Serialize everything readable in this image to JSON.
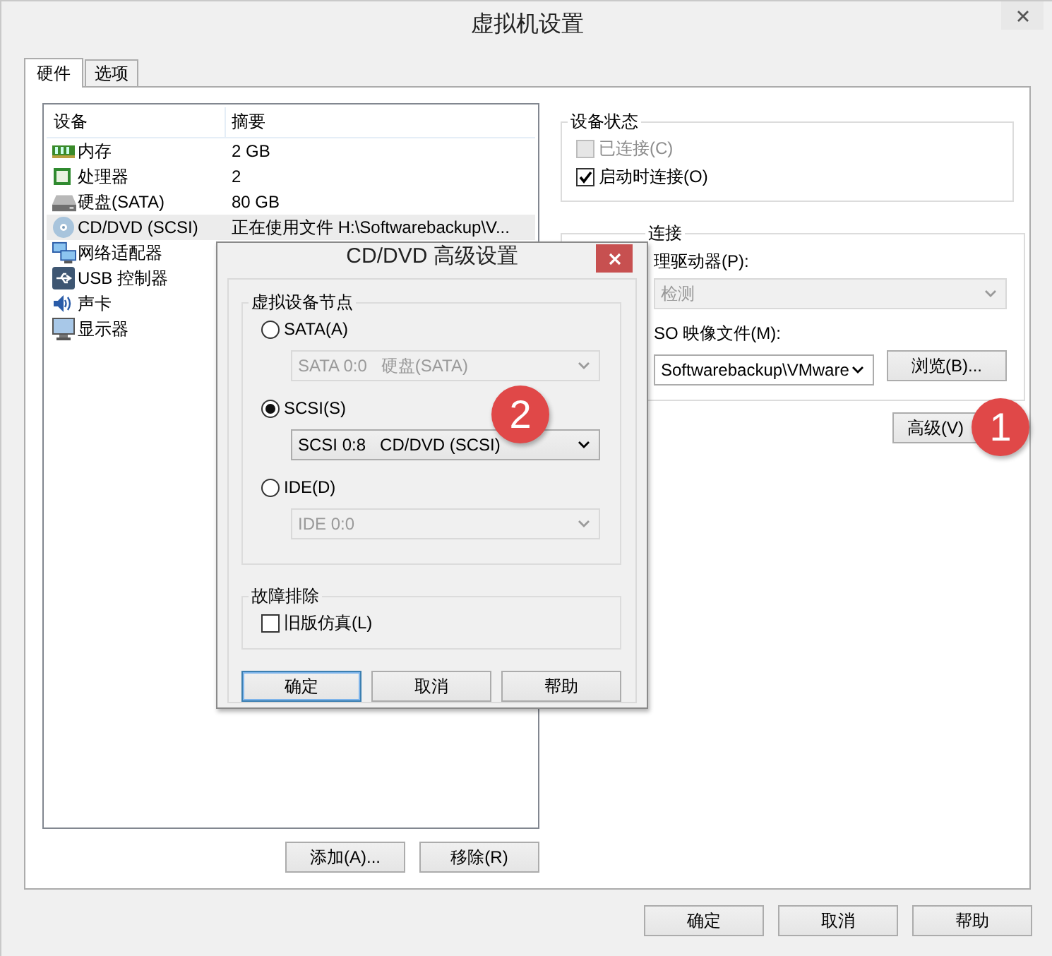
{
  "window": {
    "title": "虚拟机设置"
  },
  "tabs": [
    {
      "label": "硬件",
      "selected": true
    },
    {
      "label": "选项",
      "selected": false
    }
  ],
  "device_list": {
    "columns": [
      "设备",
      "摘要"
    ],
    "rows": [
      {
        "kind": "memory",
        "name": "内存",
        "summary": "2 GB",
        "selected": false
      },
      {
        "kind": "cpu",
        "name": "处理器",
        "summary": "2",
        "selected": false
      },
      {
        "kind": "disk",
        "name": "硬盘(SATA)",
        "summary": "80 GB",
        "selected": false
      },
      {
        "kind": "cdrom",
        "name": "CD/DVD (SCSI)",
        "summary": "正在使用文件 H:\\Softwarebackup\\V...",
        "selected": true
      },
      {
        "kind": "network",
        "name": "网络适配器",
        "selected": false
      },
      {
        "kind": "usb",
        "name": "USB 控制器",
        "selected": false
      },
      {
        "kind": "sound",
        "name": "声卡",
        "selected": false
      },
      {
        "kind": "display",
        "name": "显示器",
        "selected": false
      }
    ]
  },
  "list_buttons": [
    "添加(A)...",
    "移除(R)"
  ],
  "device_status": {
    "title": "设备状态",
    "options": [
      {
        "label": "已连接(C)",
        "checked": false,
        "disabled": true
      },
      {
        "label": "启动时连接(O)",
        "checked": true,
        "disabled": false
      }
    ]
  },
  "connection": {
    "title": "连接",
    "physical_label": "理驱动器(P):",
    "physical_value": "检测",
    "iso_label": "SO 映像文件(M):",
    "iso_value": "Softwarebackup\\VMware",
    "browse_button": "浏览(B)..."
  },
  "advanced_button": "高级(V)",
  "buttons": [
    "确定",
    "取消",
    "帮助"
  ],
  "dialog": {
    "title": "CD/DVD 高级设置",
    "group": "虚拟设备节点",
    "nodes": [
      {
        "label": "SATA(A)",
        "selected": false,
        "value": "SATA 0:0   硬盘(SATA)"
      },
      {
        "label": "SCSI(S)",
        "selected": true,
        "value": "SCSI 0:8   CD/DVD (SCSI)"
      },
      {
        "label": "IDE(D)",
        "selected": false,
        "value": "IDE 0:0"
      }
    ],
    "troubleshoot": {
      "title": "故障排除",
      "options": [
        {
          "label": "旧版仿真(L)",
          "checked": false
        }
      ]
    },
    "buttons": [
      {
        "label": "确定",
        "default": true
      },
      {
        "label": "取消",
        "default": false
      },
      {
        "label": "帮助",
        "default": false
      }
    ]
  },
  "annotations": [
    "1",
    "2"
  ]
}
